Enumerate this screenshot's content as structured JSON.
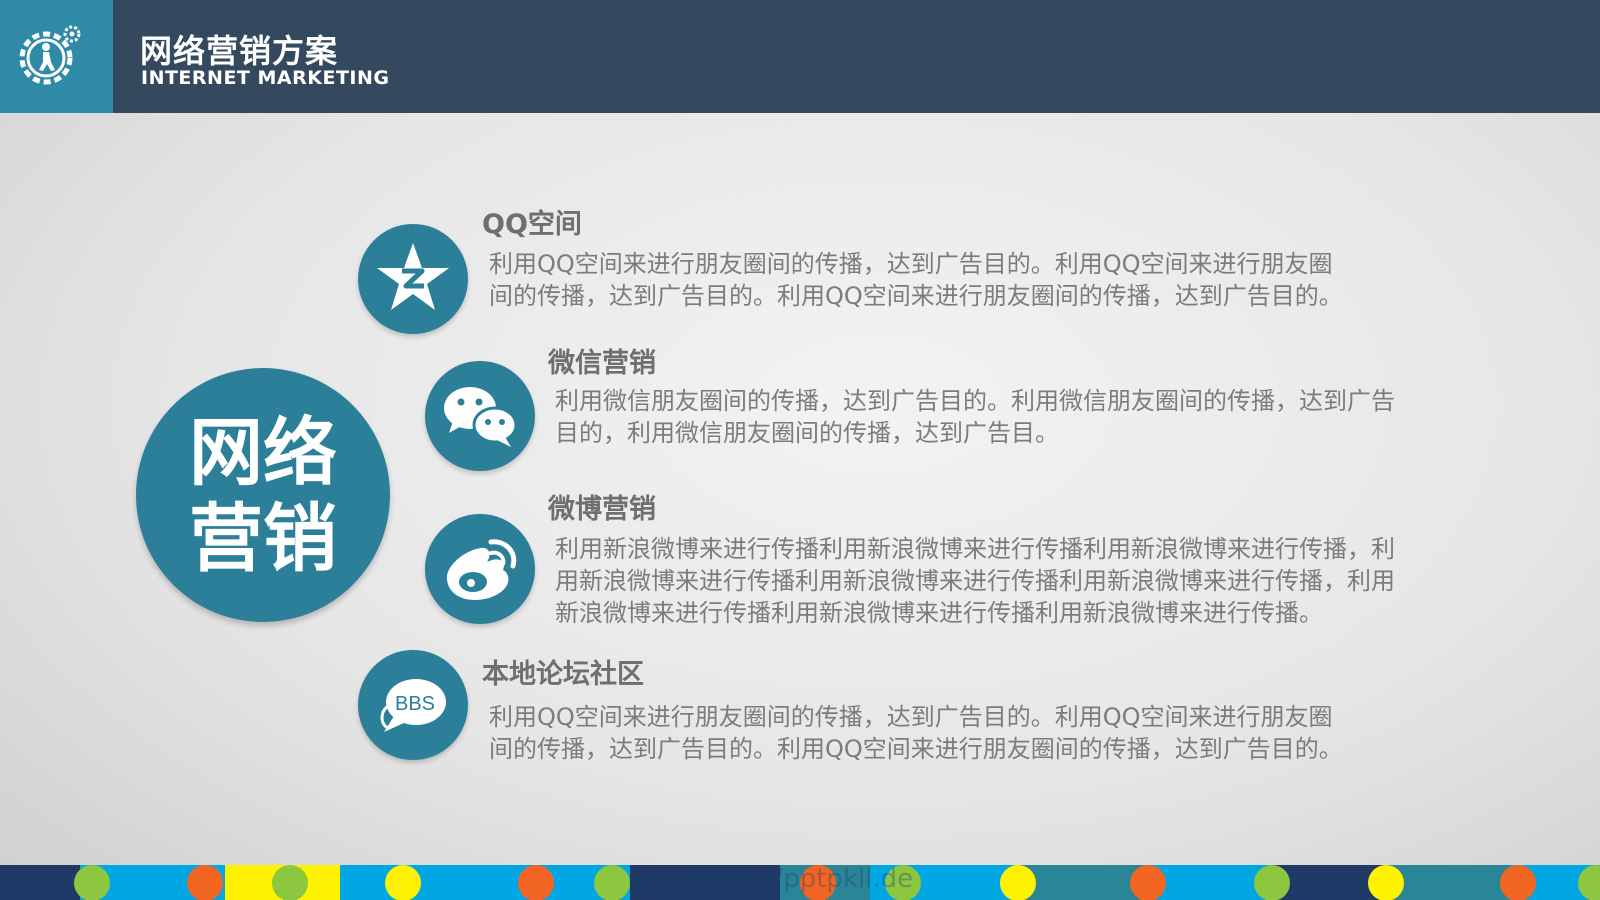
{
  "header": {
    "title_cn": "网络营销方案",
    "title_en": "INTERNET MARKETING",
    "logo_icon": "gear-person-icon"
  },
  "center": {
    "line1": "网络",
    "line2": "营销"
  },
  "items": [
    {
      "icon": "qzone-star-icon",
      "title": "QQ空间",
      "desc_lines": [
        "利用QQ空间来进行朋友圈间的传播，达到广告目的。利用QQ空间来进行朋友圈",
        "间的传播，达到广告目的。利用QQ空间来进行朋友圈间的传播，达到广告目的。"
      ]
    },
    {
      "icon": "wechat-icon",
      "title": "微信营销",
      "desc_lines": [
        "利用微信朋友圈间的传播，达到广告目的。利用微信朋友圈间的传播，达到广告",
        "目的，利用微信朋友圈间的传播，达到广告目。"
      ]
    },
    {
      "icon": "weibo-icon",
      "title": "微博营销",
      "desc_lines": [
        "利用新浪微博来进行传播利用新浪微博来进行传播利用新浪微博来进行传播，利",
        "用新浪微博来进行传播利用新浪微博来进行传播利用新浪微博来进行传播，利用",
        "新浪微博来进行传播利用新浪微博来进行传播利用新浪微博来进行传播。"
      ]
    },
    {
      "icon": "bbs-icon",
      "icon_text": "BBS",
      "title": "本地论坛社区",
      "desc_lines": [
        "利用QQ空间来进行朋友圈间的传播，达到广告目的。利用QQ空间来进行朋友圈",
        "间的传播，达到广告目的。利用QQ空间来进行朋友圈间的传播，达到广告目的。"
      ]
    }
  ],
  "footer": {
    "watermark": "https://pptpkll.de"
  },
  "colors": {
    "header_bg": "#34495e",
    "accent": "#2c7f98",
    "logo_bg": "#2e8aa7",
    "strip_blue": "#00a7e3",
    "strip_navy": "#1f3a66",
    "strip_teal": "#2a8596",
    "dot_green": "#8dc63f",
    "dot_orange": "#f26522",
    "dot_yellow": "#fff200"
  }
}
